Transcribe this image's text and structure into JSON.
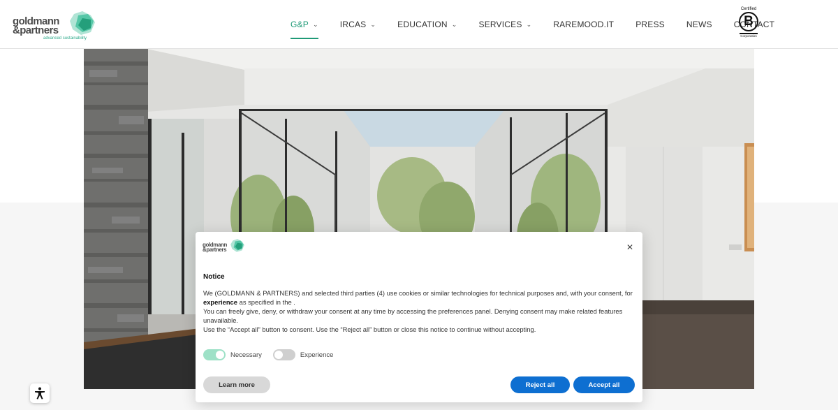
{
  "header": {
    "logo_text_line1": "goldmann",
    "logo_text_line2": "&partners",
    "logo_tagline": "advanced sustainability",
    "nav": [
      {
        "label": "G&P",
        "dropdown": true,
        "active": true
      },
      {
        "label": "IRCAS",
        "dropdown": true
      },
      {
        "label": "EDUCATION",
        "dropdown": true
      },
      {
        "label": "SERVICES",
        "dropdown": true
      },
      {
        "label": "RAREMOOD.IT",
        "dropdown": false
      },
      {
        "label": "PRESS",
        "dropdown": false
      },
      {
        "label": "NEWS",
        "dropdown": false
      },
      {
        "label": "CONTACT",
        "dropdown": false
      }
    ],
    "bcorp": {
      "top": "Certified",
      "letter": "B",
      "bottom": "Corporation"
    }
  },
  "colors": {
    "accent": "#1f9a77",
    "button_blue": "#0e6fd1",
    "toggle_on": "#9ee1c7"
  },
  "dialog": {
    "logo_line1": "goldmann",
    "logo_line2": "&partners",
    "close_icon": "close-icon",
    "title": "Notice",
    "body_1a": "We (GOLDMANN & PARTNERS) and selected third parties (4) use cookies or similar technologies for technical purposes and, with your consent, for",
    "body_1b_bold": "experience",
    "body_1c": "as specified in the .",
    "body_2": "You can freely give, deny, or withdraw your consent at any time by accessing the preferences panel. Denying consent may make related features unavailable.",
    "body_3": "Use the “Accept all” button to consent. Use the “Reject all” button or close this notice to continue without accepting.",
    "toggles": [
      {
        "label": "Necessary",
        "on": true
      },
      {
        "label": "Experience",
        "on": false
      }
    ],
    "learn_more": "Learn more",
    "reject_all": "Reject all",
    "accept_all": "Accept all"
  },
  "accessibility_icon": "accessibility-icon"
}
